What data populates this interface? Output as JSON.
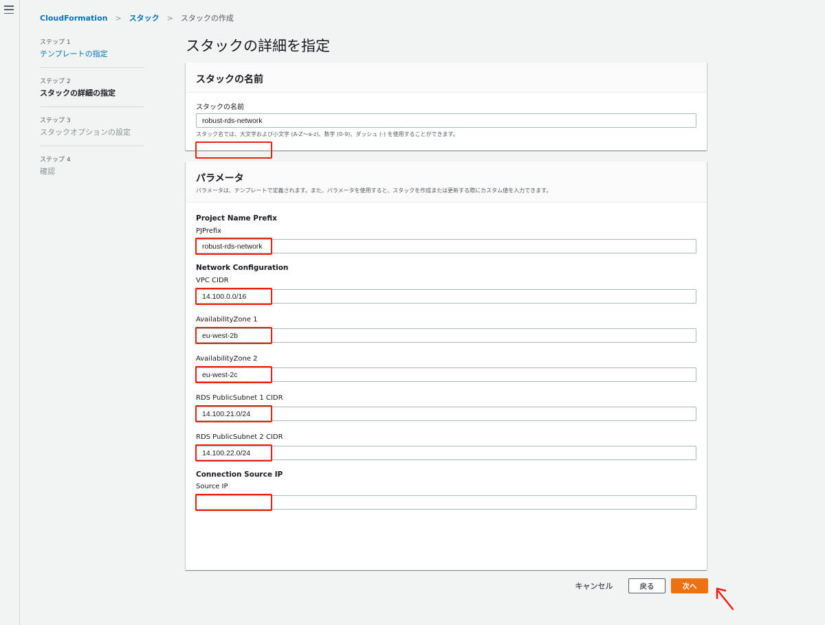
{
  "breadcrumb": {
    "root": "CloudFormation",
    "stacks": "スタック",
    "current": "スタックの作成"
  },
  "steps": [
    {
      "num": "ステップ 1",
      "title": "テンプレートの指定",
      "state": "link"
    },
    {
      "num": "ステップ 2",
      "title": "スタックの詳細の指定",
      "state": "active"
    },
    {
      "num": "ステップ 3",
      "title": "スタックオプションの設定",
      "state": "disabled"
    },
    {
      "num": "ステップ 4",
      "title": "確認",
      "state": "disabled"
    }
  ],
  "page_title": "スタックの詳細を指定",
  "stack_name_panel": {
    "heading": "スタックの名前",
    "label": "スタックの名前",
    "value": "robust-rds-network",
    "hint": "スタック名では、大文字および小文字 (A-Z〜a-z)、数字 (0-9)、ダッシュ (-) を使用することができます。"
  },
  "params_panel": {
    "heading": "パラメータ",
    "description": "パラメータは、テンプレートで定義されます。また、パラメータを使用すると、スタックを作成または更新する際にカスタム値を入力できます。",
    "groups": {
      "project": "Project Name Prefix",
      "network": "Network Configuration",
      "connection": "Connection Source IP"
    },
    "fields": {
      "pjprefix": {
        "label": "PJPrefix",
        "value": "robust-rds-network"
      },
      "vpc_cidr": {
        "label": "VPC CIDR",
        "value": "14.100.0.0/16"
      },
      "az1": {
        "label": "AvailabilityZone 1",
        "value": "eu-west-2b"
      },
      "az2": {
        "label": "AvailabilityZone 2",
        "value": "eu-west-2c"
      },
      "subnet1": {
        "label": "RDS PublicSubnet 1 CIDR",
        "value": "14.100.21.0/24"
      },
      "subnet2": {
        "label": "RDS PublicSubnet 2 CIDR",
        "value": "14.100.22.0/24"
      },
      "source_ip": {
        "label": "Source IP",
        "value": ""
      }
    }
  },
  "actions": {
    "cancel": "キャンセル",
    "back": "戻る",
    "next": "次へ"
  },
  "colors": {
    "primary": "#ec7211",
    "link": "#0073bb",
    "annotation": "#e8200c"
  }
}
